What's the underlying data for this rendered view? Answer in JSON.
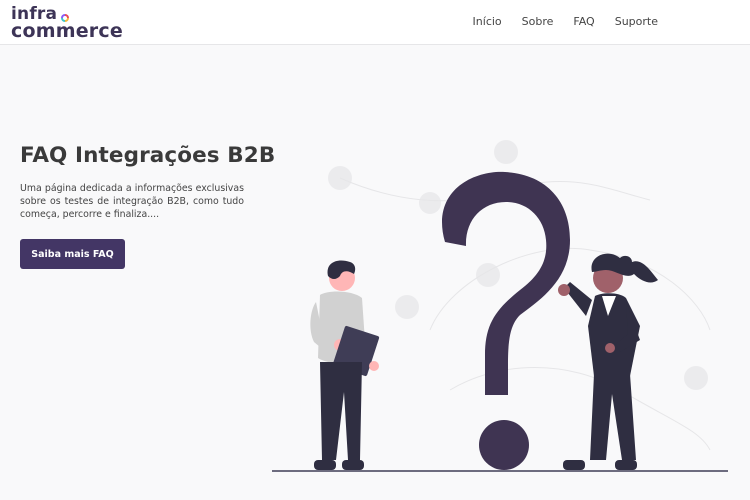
{
  "header": {
    "logo": {
      "line1": "infra",
      "line2": "commerce"
    },
    "nav": [
      "Início",
      "Sobre",
      "FAQ",
      "Suporte"
    ]
  },
  "hero": {
    "title": "FAQ Integrações B2B",
    "description": "Uma página dedicada a informações exclusivas sobre os testes de integração B2B, como tudo começa, percorre e finaliza....",
    "cta_label": "Saiba mais FAQ"
  },
  "colors": {
    "brand": "#433665",
    "question_mark": "#3f3452",
    "background": "#f9f9fa"
  }
}
